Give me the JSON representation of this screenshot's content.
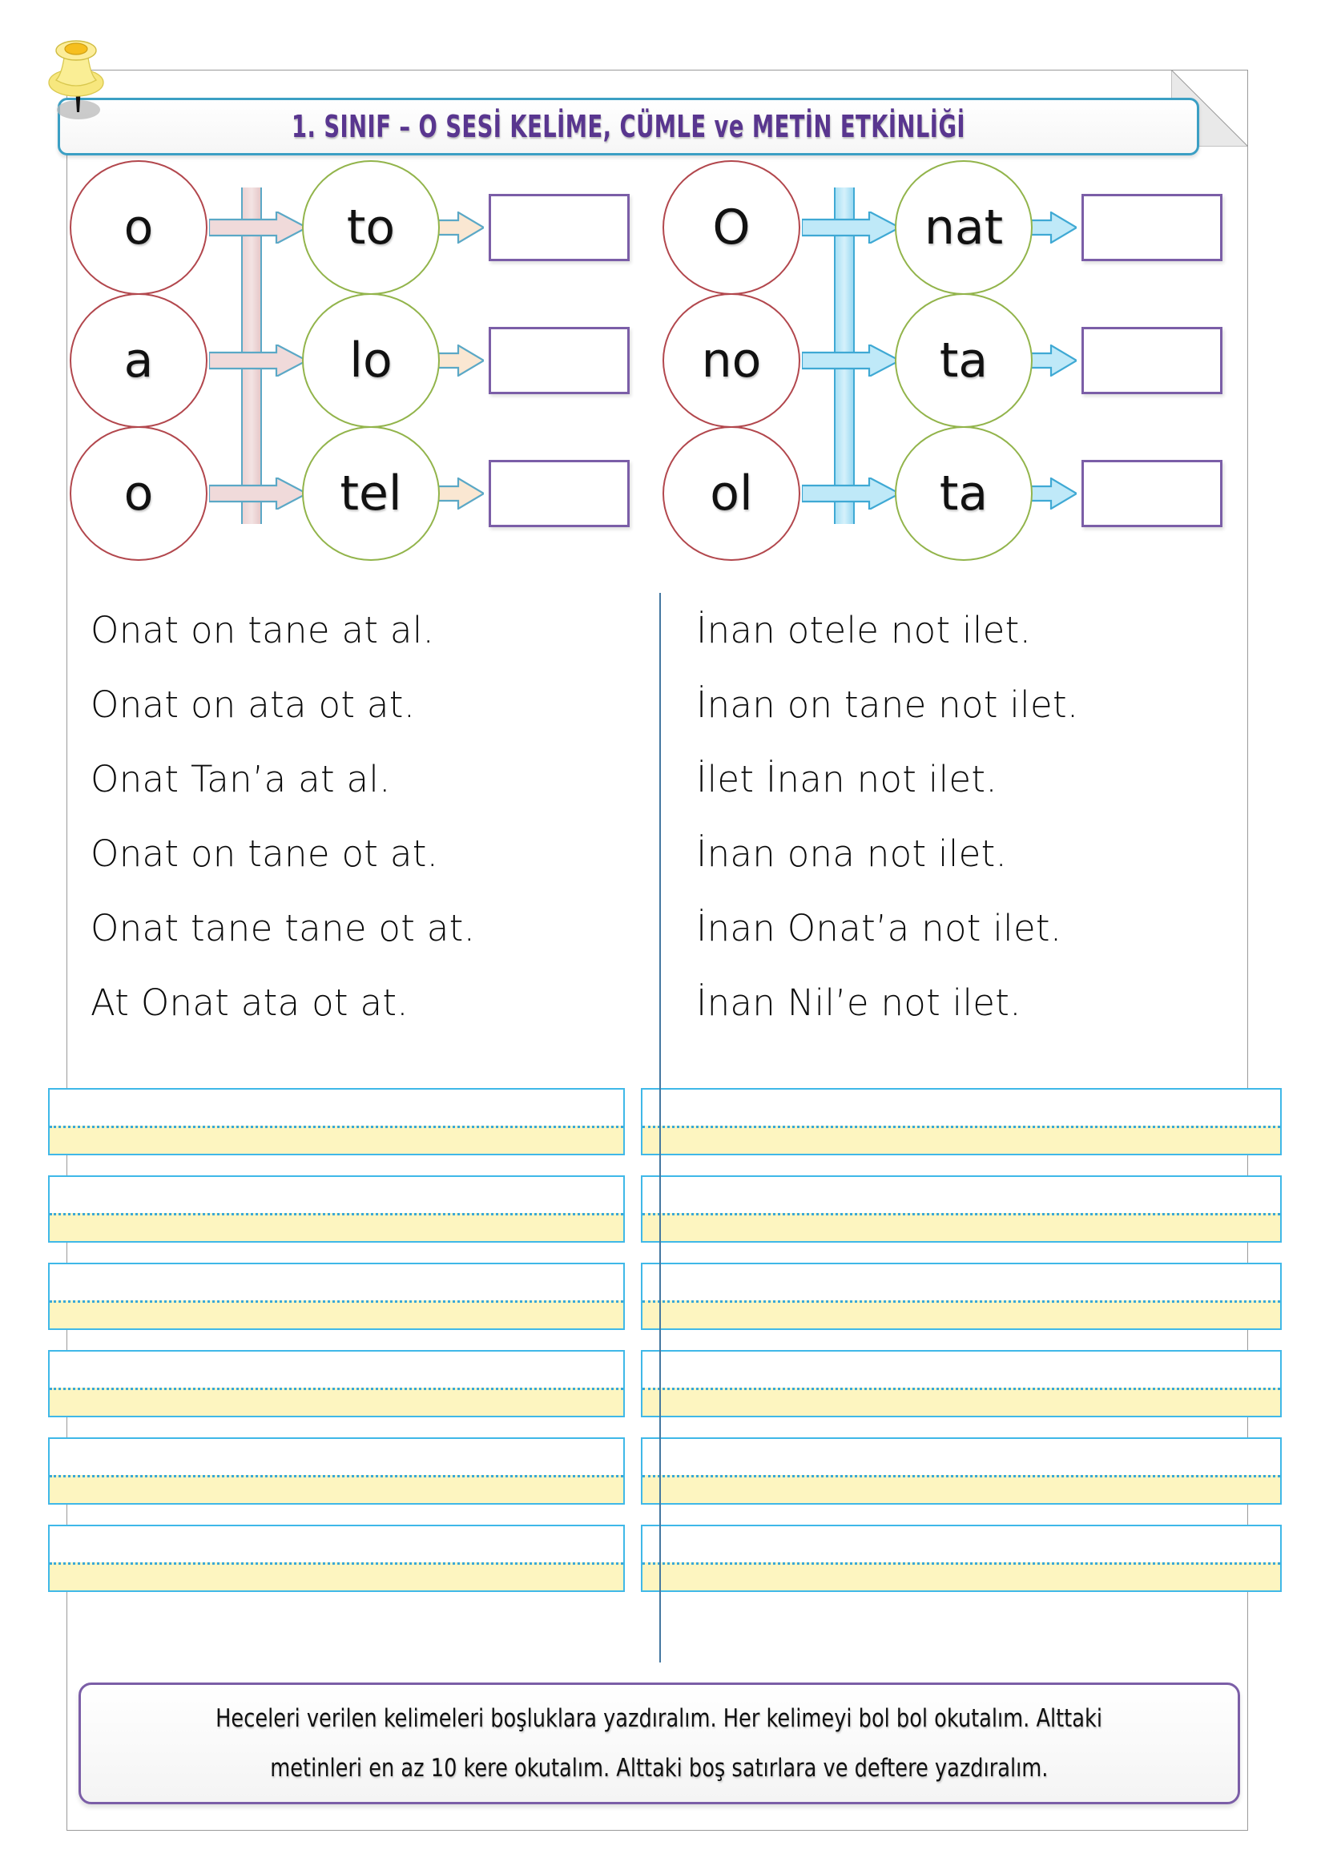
{
  "header": {
    "title": "1. SINIF – O SESİ KELİME, CÜMLE ve METİN ETKİNLİĞİ",
    "title_color": "#59368f",
    "border_color": "#3b9fc4",
    "pin_icon": "pushpin-icon"
  },
  "syllable_exercise": {
    "groups": [
      {
        "accent_color": "#ecd3d4",
        "arrow_color": "#f3e3e3",
        "rows": [
          {
            "source": "o",
            "target": "to",
            "answer": ""
          },
          {
            "source": "a",
            "target": "lo",
            "answer": ""
          },
          {
            "source": "o",
            "target": "tel",
            "answer": ""
          }
        ]
      },
      {
        "accent_color": "#a8e0f4",
        "arrow_color": "#bfe9f8",
        "rows": [
          {
            "source": "O",
            "target": "nat",
            "answer": ""
          },
          {
            "source": "no",
            "target": "ta",
            "answer": ""
          },
          {
            "source": "ol",
            "target": "ta",
            "answer": ""
          }
        ]
      }
    ],
    "source_circle_color": "#b2474d",
    "target_circle_color": "#92b44b",
    "answer_box_color": "#7b5ea7"
  },
  "reading_texts": {
    "left_column": [
      "Onat on tane at al.",
      "Onat on ata ot at.",
      "Onat Tan’a at al.",
      "Onat on tane ot at.",
      "Onat tane tane ot at.",
      "At Onat ata ot at."
    ],
    "right_column": [
      "İnan otele not ilet.",
      "İnan on tane not ilet.",
      "İlet İnan not ilet.",
      "İnan ona not ilet.",
      "İnan Onat’a not ilet.",
      "İnan Nil’e not ilet."
    ]
  },
  "writing_lines": {
    "row_count": 6,
    "columns_per_row": 2,
    "border_color": "#3fb8e8",
    "midline_color": "#39a8d8",
    "lower_band_color": "#fdf5c0"
  },
  "footer": {
    "line1": "Heceleri verilen kelimeleri boşluklara yazdıralım. Her kelimeyi bol bol okutalım.  Alttaki",
    "line2": "metinleri en az 10 kere okutalım. Alttaki boş satırlara ve deftere yazdıralım.",
    "border_color": "#7b5ea7"
  }
}
